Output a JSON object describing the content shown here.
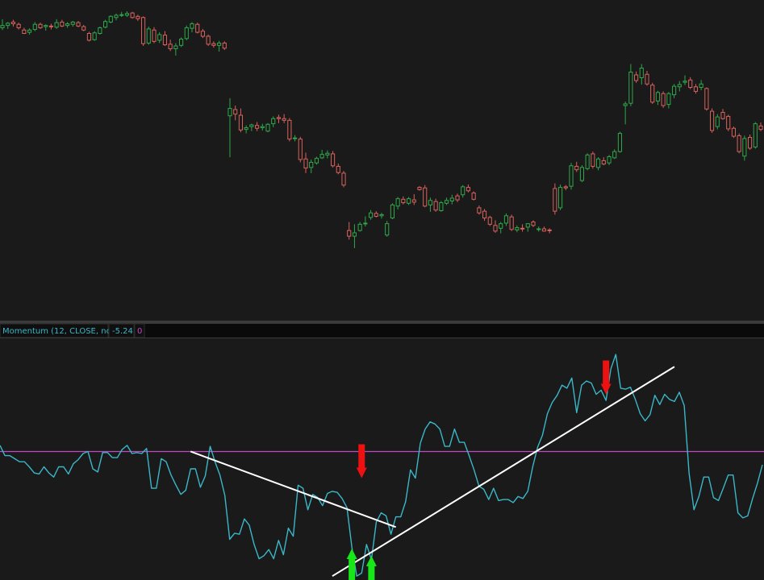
{
  "colors": {
    "background": "#1a1a1a",
    "up": "#2ea84a",
    "down": "#d9615b",
    "momentum": "#3ab7c8",
    "zero_line": "#c248c4",
    "trendline": "#ffffff",
    "arrow_up": "#19e619",
    "arrow_down": "#ee1111",
    "header_text": "#3ab7c8",
    "header_zero": "#c248c4"
  },
  "indicator_header": {
    "name": "Momentum (12, CLOSE, no)",
    "value": "-5.24",
    "zero": "0"
  },
  "chart_data": [
    {
      "type": "candlestick",
      "ohlc": [
        [
          100,
          101.5,
          99.6,
          100.4
        ],
        [
          100.4,
          101,
          99.8,
          100.8
        ],
        [
          101,
          101.4,
          100.2,
          100.7
        ],
        [
          100.6,
          100.9,
          99.7,
          100.0
        ],
        [
          99.6,
          100.0,
          98.9,
          99.0
        ],
        [
          99.2,
          99.9,
          98.8,
          99.6
        ],
        [
          99.7,
          101.0,
          99.4,
          100.6
        ],
        [
          100.6,
          100.9,
          99.8,
          100.0
        ],
        [
          100.2,
          100.6,
          99.5,
          100.4
        ],
        [
          100.3,
          100.7,
          99.7,
          100.2
        ],
        [
          100.1,
          101.5,
          99.8,
          100.9
        ],
        [
          101.0,
          101.4,
          100.1,
          100.3
        ],
        [
          100.4,
          101.0,
          100.0,
          100.7
        ],
        [
          100.6,
          101.2,
          100.2,
          101.0
        ],
        [
          100.9,
          101.2,
          100.1,
          100.3
        ],
        [
          100.2,
          100.5,
          99.4,
          99.6
        ],
        [
          99.0,
          99.3,
          97.6,
          97.8
        ],
        [
          97.9,
          99.4,
          97.7,
          99.1
        ],
        [
          99.0,
          100.2,
          98.8,
          100.0
        ],
        [
          100.1,
          101.4,
          99.9,
          101.1
        ],
        [
          101.0,
          102.2,
          100.8,
          102.0
        ],
        [
          101.8,
          102.5,
          101.3,
          102.2
        ],
        [
          102.3,
          102.8,
          101.9,
          102.3
        ],
        [
          102.2,
          102.9,
          101.9,
          102.5
        ],
        [
          102.6,
          102.8,
          101.6,
          101.8
        ],
        [
          102.0,
          102.3,
          101.2,
          101.6
        ],
        [
          101.8,
          102.0,
          96.8,
          97.2
        ],
        [
          97.3,
          100.2,
          97.0,
          99.8
        ],
        [
          99.6,
          100.1,
          97.3,
          97.6
        ],
        [
          97.8,
          99.2,
          97.3,
          98.8
        ],
        [
          98.7,
          99.4,
          96.8,
          97.0
        ],
        [
          97.1,
          97.9,
          95.9,
          96.3
        ],
        [
          96.3,
          97.3,
          95.1,
          96.8
        ],
        [
          96.9,
          98.3,
          96.6,
          98.0
        ],
        [
          98.1,
          100.4,
          97.8,
          100.0
        ],
        [
          99.9,
          101.0,
          99.2,
          100.7
        ],
        [
          100.6,
          100.9,
          99.0,
          99.2
        ],
        [
          99.4,
          99.8,
          98.2,
          98.5
        ],
        [
          98.5,
          98.8,
          96.8,
          97.1
        ],
        [
          97.2,
          97.6,
          96.5,
          96.9
        ],
        [
          96.9,
          97.7,
          95.8,
          97.3
        ],
        [
          97.3,
          97.6,
          96.1,
          96.4
        ],
        [
          84.5,
          87.6,
          77.2,
          85.8
        ],
        [
          85.6,
          86.3,
          83.7,
          84.8
        ],
        [
          84.6,
          85.8,
          81.6,
          82.0
        ],
        [
          82.1,
          82.8,
          81.4,
          82.4
        ],
        [
          82.6,
          83.1,
          81.8,
          82.9
        ],
        [
          82.8,
          83.4,
          81.8,
          82.3
        ],
        [
          82.4,
          83.1,
          81.9,
          82.6
        ],
        [
          81.8,
          83.2,
          81.6,
          83.0
        ],
        [
          83.1,
          84.4,
          82.5,
          84.0
        ],
        [
          84.2,
          84.7,
          83.2,
          84.0
        ],
        [
          84.0,
          84.8,
          83.2,
          83.7
        ],
        [
          83.7,
          84.1,
          80.0,
          80.4
        ],
        [
          80.6,
          81.1,
          80.0,
          80.6
        ],
        [
          80.4,
          80.8,
          76.3,
          76.8
        ],
        [
          76.9,
          78.0,
          74.4,
          75.3
        ],
        [
          75.4,
          76.8,
          74.4,
          76.3
        ],
        [
          76.2,
          77.3,
          75.9,
          77.0
        ],
        [
          77.1,
          78.5,
          76.9,
          77.7
        ],
        [
          77.6,
          78.4,
          77.0,
          77.9
        ],
        [
          77.8,
          78.3,
          75.4,
          75.7
        ],
        [
          75.6,
          76.1,
          74.2,
          74.5
        ],
        [
          74.4,
          74.8,
          71.9,
          72.3
        ],
        [
          64.3,
          65.8,
          62.7,
          63.3
        ],
        [
          63.3,
          65.4,
          61.2,
          63.9
        ],
        [
          64.3,
          65.8,
          64.1,
          65.4
        ],
        [
          65.5,
          66.8,
          65.0,
          65.6
        ],
        [
          66.6,
          67.9,
          66.2,
          67.4
        ],
        [
          67.3,
          67.7,
          66.6,
          66.8
        ],
        [
          66.9,
          67.4,
          66.4,
          67.1
        ],
        [
          63.5,
          66.0,
          63.2,
          65.5
        ],
        [
          66.5,
          69.1,
          66.3,
          68.8
        ],
        [
          68.6,
          70.2,
          68.0,
          69.9
        ],
        [
          69.8,
          70.3,
          68.9,
          69.2
        ],
        [
          69.1,
          70.2,
          68.8,
          69.9
        ],
        [
          69.7,
          70.7,
          68.8,
          69.3
        ],
        [
          71.9,
          72.1,
          71.3,
          71.5
        ],
        [
          71.8,
          72.3,
          68.4,
          68.6
        ],
        [
          68.8,
          70.1,
          67.6,
          69.6
        ],
        [
          69.4,
          69.9,
          67.6,
          67.9
        ],
        [
          67.8,
          69.5,
          67.6,
          69.2
        ],
        [
          69.1,
          70.1,
          68.8,
          69.6
        ],
        [
          69.5,
          70.6,
          68.9,
          70.0
        ],
        [
          70.4,
          70.8,
          69.3,
          69.7
        ],
        [
          70.6,
          72.3,
          70.1,
          72.0
        ],
        [
          71.9,
          72.4,
          71.0,
          71.3
        ],
        [
          70.9,
          71.2,
          69.6,
          69.8
        ],
        [
          68.3,
          68.7,
          67.1,
          67.4
        ],
        [
          67.7,
          68.1,
          66.0,
          66.5
        ],
        [
          66.6,
          66.9,
          65.1,
          65.4
        ],
        [
          65.2,
          66.1,
          63.9,
          64.2
        ],
        [
          64.7,
          65.8,
          63.8,
          65.5
        ],
        [
          65.6,
          67.3,
          65.1,
          66.9
        ],
        [
          66.7,
          67.1,
          64.2,
          64.5
        ],
        [
          64.4,
          65.2,
          64.0,
          64.8
        ],
        [
          64.7,
          65.4,
          64.1,
          64.6
        ],
        [
          64.9,
          65.6,
          64.1,
          65.5
        ],
        [
          65.8,
          66.1,
          64.9,
          65.2
        ],
        [
          64.6,
          65.0,
          64.1,
          64.6
        ],
        [
          64.6,
          65.0,
          64.1,
          64.2
        ],
        [
          64.4,
          64.7,
          63.8,
          64.3
        ],
        [
          71.7,
          72.6,
          67.1,
          67.7
        ],
        [
          68.3,
          72.4,
          67.9,
          71.9
        ],
        [
          72.0,
          72.3,
          71.4,
          71.8
        ],
        [
          72.1,
          76.2,
          71.5,
          75.7
        ],
        [
          75.6,
          76.4,
          74.6,
          75.0
        ],
        [
          73.1,
          75.8,
          72.8,
          75.4
        ],
        [
          75.2,
          77.9,
          74.9,
          77.6
        ],
        [
          77.8,
          78.2,
          75.2,
          75.6
        ],
        [
          75.4,
          77.2,
          74.9,
          76.9
        ],
        [
          76.6,
          77.2,
          75.8,
          76.0
        ],
        [
          76.2,
          77.6,
          75.8,
          77.3
        ],
        [
          77.1,
          78.6,
          76.9,
          78.2
        ],
        [
          78.2,
          81.7,
          78.0,
          81.4
        ],
        [
          86.3,
          87.0,
          83.0,
          86.6
        ],
        [
          86.7,
          93.6,
          86.2,
          92.2
        ],
        [
          91.7,
          92.3,
          90.3,
          90.7
        ],
        [
          91.2,
          93.6,
          90.0,
          92.9
        ],
        [
          91.8,
          92.4,
          89.8,
          90.1
        ],
        [
          89.9,
          90.3,
          86.6,
          86.9
        ],
        [
          87.1,
          88.9,
          86.4,
          88.6
        ],
        [
          88.4,
          88.8,
          85.9,
          86.3
        ],
        [
          86.5,
          88.7,
          85.8,
          88.4
        ],
        [
          88.2,
          90.1,
          87.6,
          89.7
        ],
        [
          89.6,
          90.6,
          88.8,
          90.0
        ],
        [
          90.4,
          91.6,
          89.9,
          90.6
        ],
        [
          90.8,
          91.3,
          89.2,
          89.5
        ],
        [
          89.6,
          90.1,
          88.4,
          88.8
        ],
        [
          89.5,
          90.8,
          89.0,
          90.1
        ],
        [
          89.3,
          89.5,
          85.4,
          85.7
        ],
        [
          85.3,
          85.8,
          81.5,
          81.9
        ],
        [
          82.6,
          84.8,
          82.1,
          84.3
        ],
        [
          85.1,
          85.7,
          83.8,
          84.0
        ],
        [
          84.4,
          84.7,
          81.8,
          82.2
        ],
        [
          82.3,
          82.6,
          80.6,
          80.9
        ],
        [
          81.0,
          81.4,
          77.9,
          78.2
        ],
        [
          77.4,
          81.0,
          76.6,
          80.5
        ],
        [
          80.7,
          81.2,
          78.5,
          78.8
        ],
        [
          79.0,
          83.4,
          78.7,
          83.1
        ],
        [
          82.7,
          83.3,
          81.8,
          82.1
        ]
      ]
    },
    {
      "type": "line",
      "title": "Momentum (12, CLOSE, no)",
      "last_value": -5.24,
      "zero_line": 0,
      "ylim": [
        -12.5,
        11
      ],
      "values": [
        0.6,
        -0.4,
        -0.4,
        -0.7,
        -1.0,
        -1.0,
        -1.5,
        -2.1,
        -2.2,
        -1.5,
        -2.1,
        -2.5,
        -1.5,
        -1.5,
        -2.2,
        -1.2,
        -0.8,
        -0.2,
        0.0,
        -1.7,
        -2.0,
        -0.1,
        -0.1,
        -0.6,
        -0.6,
        0.2,
        0.6,
        -0.2,
        -0.1,
        -0.2,
        0.3,
        -3.6,
        -3.6,
        -0.7,
        -1.0,
        -2.3,
        -3.3,
        -4.2,
        -3.8,
        -1.7,
        -1.7,
        -3.5,
        -2.4,
        0.5,
        -1.0,
        -2.3,
        -4.3,
        -8.6,
        -8.0,
        -8.1,
        -6.6,
        -7.2,
        -9.1,
        -10.5,
        -10.2,
        -9.6,
        -10.5,
        -8.7,
        -10.1,
        -7.5,
        -8.3,
        -3.3,
        -3.6,
        -5.7,
        -4.2,
        -4.5,
        -5.3,
        -4.1,
        -3.9,
        -4.0,
        -4.6,
        -5.5,
        -9.4,
        -12.2,
        -11.9,
        -9.1,
        -10.6,
        -6.9,
        -6.0,
        -6.3,
        -8.1,
        -6.4,
        -6.4,
        -4.9,
        -1.8,
        -2.6,
        0.8,
        2.2,
        2.9,
        2.7,
        2.2,
        0.5,
        0.5,
        2.2,
        0.9,
        0.9,
        -0.4,
        -1.8,
        -3.4,
        -3.7,
        -4.7,
        -3.6,
        -4.8,
        -4.7,
        -4.7,
        -5.0,
        -4.4,
        -4.6,
        -3.9,
        -1.5,
        0.4,
        1.6,
        3.7,
        4.8,
        5.5,
        6.5,
        6.2,
        7.2,
        3.8,
        6.5,
        6.9,
        6.7,
        5.6,
        6.0,
        5.0,
        8.1,
        9.5,
        6.2,
        6.1,
        6.3,
        5.1,
        3.7,
        3.0,
        3.6,
        5.5,
        4.6,
        5.6,
        5.1,
        4.9,
        5.8,
        4.5,
        -2.1,
        -5.7,
        -4.4,
        -2.5,
        -2.5,
        -4.5,
        -4.8,
        -3.6,
        -2.3,
        -2.3,
        -6.0,
        -6.5,
        -6.3,
        -4.6,
        -3.1,
        -1.3
      ],
      "trendlines": [
        {
          "from": [
            39,
            0.0
          ],
          "to": [
            81,
            -7.4
          ]
        },
        {
          "from": [
            68,
            -12.2
          ],
          "to": [
            138,
            8.3
          ]
        }
      ],
      "annotations": [
        {
          "kind": "arrow-down",
          "at": [
            74,
            -2.6
          ]
        },
        {
          "kind": "arrow-up",
          "at": [
            72,
            -9.5
          ]
        },
        {
          "kind": "arrow-up",
          "at": [
            76,
            -10.2
          ]
        },
        {
          "kind": "arrow-down",
          "at": [
            124,
            5.6
          ]
        }
      ]
    }
  ]
}
